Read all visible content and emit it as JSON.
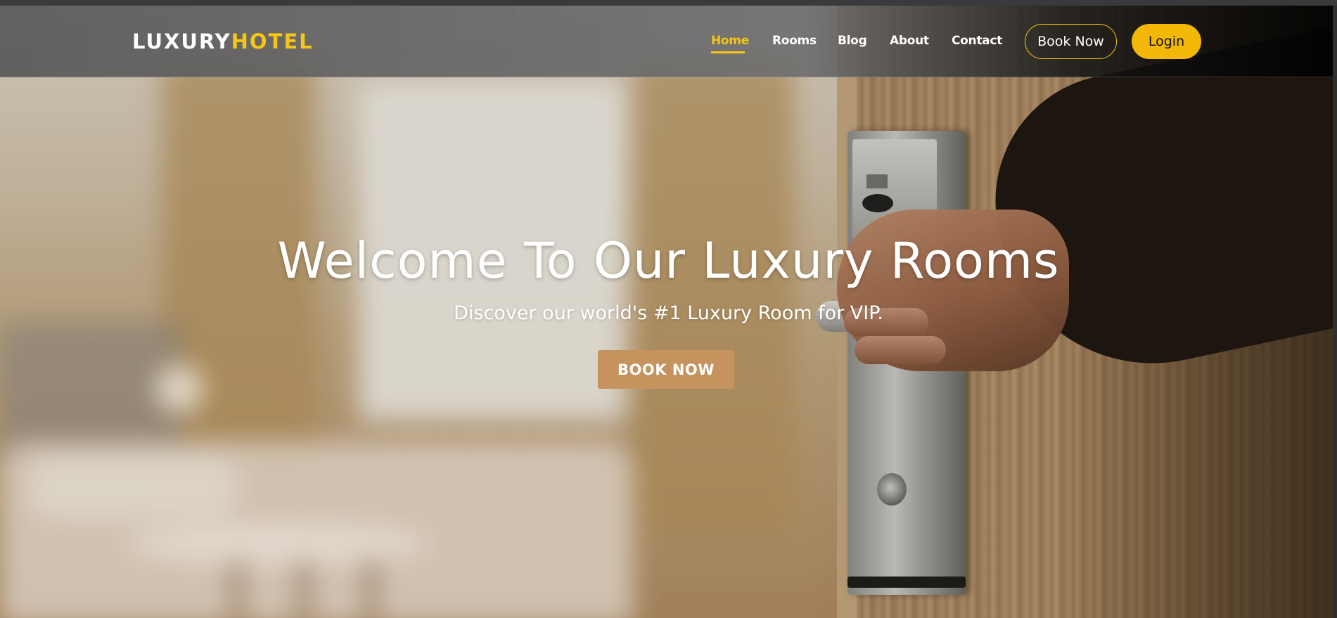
{
  "navbar": {
    "logo_primary": "LUXURY",
    "logo_accent": "HOTEL",
    "links": [
      {
        "label": "Home",
        "active": true
      },
      {
        "label": "Rooms",
        "active": false
      },
      {
        "label": "Blog",
        "active": false
      },
      {
        "label": "About",
        "active": false
      },
      {
        "label": "Contact",
        "active": false
      }
    ],
    "book_now_label": "Book Now",
    "login_label": "Login"
  },
  "hero": {
    "title": "Welcome To Our Luxury Rooms",
    "subtitle": "Discover our world's #1 Luxury Room for VIP.",
    "cta_label": "BOOK NOW",
    "image": "hotel-room-door-background"
  },
  "colors": {
    "accent": "#f5c518",
    "login_button": "#f2b707",
    "cta_button": "#c6935f"
  }
}
